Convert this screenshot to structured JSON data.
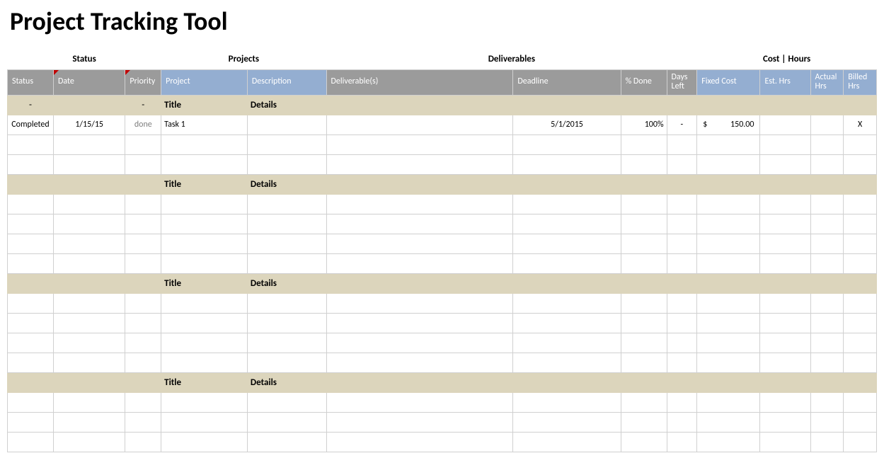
{
  "title": "Project Tracking Tool",
  "groups": {
    "status": "Status",
    "projects": "Projects",
    "deliverables": "Deliverables",
    "costhours": "Cost | Hours"
  },
  "headers": {
    "status": "Status",
    "date": "Date",
    "priority": "Priority",
    "project": "Project",
    "description": "Description",
    "deliverable": "Deliverable(s)",
    "deadline": "Deadline",
    "pctdone": "% Done",
    "daysleft": "Days Left",
    "fixedcost": "Fixed Cost",
    "esthrs": "Est. Hrs",
    "acthrs": "Actual Hrs",
    "bilhrs": "Billed Hrs"
  },
  "section_labels": {
    "dash": "-",
    "title": "Title",
    "details": "Details"
  },
  "row1": {
    "status": "Completed",
    "date": "1/15/15",
    "priority": "done",
    "project": "Task 1",
    "deadline": "5/1/2015",
    "pctdone": "100%",
    "daysleft": "-",
    "cost_currency": "$",
    "cost_value": "150.00",
    "billed": "X"
  }
}
